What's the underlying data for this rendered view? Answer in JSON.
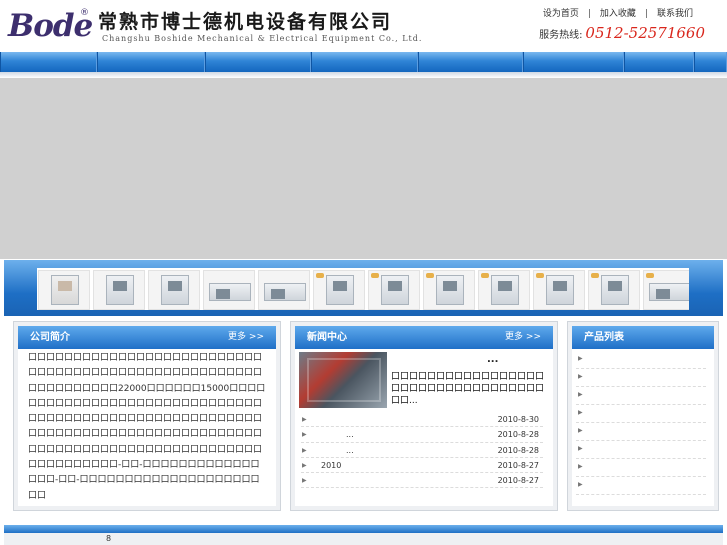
{
  "header": {
    "logo_text": "Bode",
    "logo_reg": "®",
    "company_cn": "常熟市博士德机电设备有限公司",
    "company_en": "Changshu Boshide Mechanical & Electrical Equipment Co., Ltd.",
    "links": [
      "设为首页",
      "加入收藏",
      "联系我们"
    ],
    "link_sep": "|",
    "hotline_label": "服务热线:",
    "hotline_number": "0512-52571660"
  },
  "nav": {
    "items": 8
  },
  "about": {
    "title": "公司简介",
    "more": "更多 >>",
    "text": "口口口口口口口口口口口口口口口口口口口口口口口口口口口口口口口口口口口口口口口口口口口口口口口口口口口口口口口口口口口口口口22000口口口口口口15000口口口口口口口口口口口口口口口口口口口口口口口口口口口口口口口口口口口口口口口口口口口口口口口口口口口口口口口口口口口口口口口口口口口口口口口口口口口口口口口口口口口口口口口口口口口口口口口口口口口口口口口口口口口口口口口口口口口口口口-口口-口口口口口口口口口口口口口口口口-口口-口口口口口口口口口口口口口口口口口口口口口口"
  },
  "news": {
    "title": "新闻中心",
    "more": "更多 >>",
    "top_title": "...",
    "top_desc": "口口口口口口口口口口口口口口口口口口口口口口口口口口口口口口口口口口口口...",
    "rows": [
      {
        "title": "",
        "date": "2010-8-30"
      },
      {
        "title": "...",
        "date": "2010-8-28"
      },
      {
        "title": "...",
        "date": "2010-8-28"
      },
      {
        "title": "2010",
        "date": "2010-8-27"
      },
      {
        "title": "",
        "date": "2010-8-27"
      }
    ]
  },
  "products": {
    "title": "产品列表",
    "items": [
      "",
      "",
      "",
      "",
      "",
      "",
      "",
      ""
    ]
  },
  "footer": {
    "text": "8"
  },
  "colors": {
    "brand_blue": "#1f6fc7",
    "hotline_red": "#d9261c",
    "logo_purple": "#3d2f6e"
  }
}
